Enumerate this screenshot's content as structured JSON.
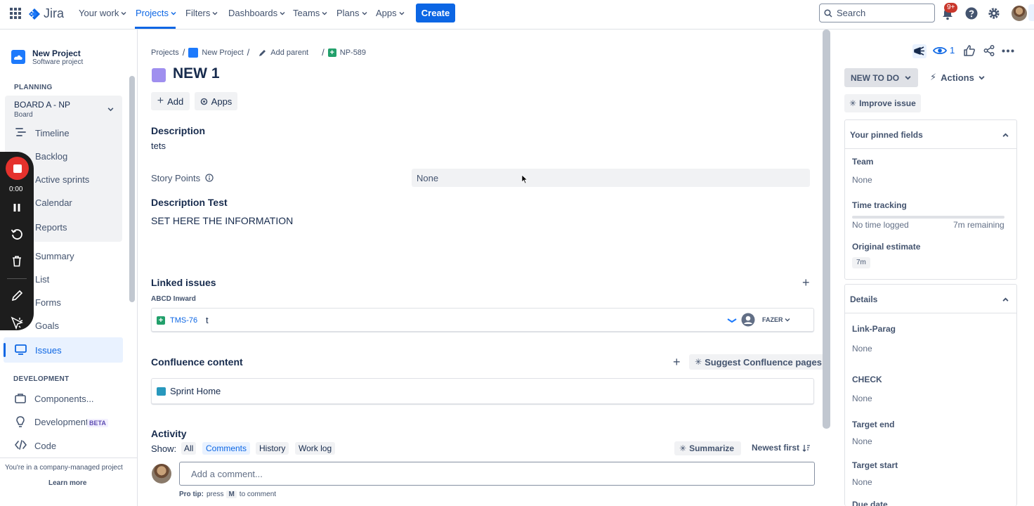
{
  "topnav": {
    "brand": "Jira",
    "items": [
      "Your work",
      "Projects",
      "Filters",
      "Dashboards",
      "Teams",
      "Plans",
      "Apps"
    ],
    "create": "Create",
    "search_placeholder": "Search",
    "notif_badge": "9+"
  },
  "sidebar": {
    "project_name": "New Project",
    "project_type": "Software project",
    "planning_header": "PLANNING",
    "board_name": "BOARD A - NP",
    "board_sub": "Board",
    "planning_items": [
      "Timeline",
      "Backlog",
      "Active sprints",
      "Calendar",
      "Reports"
    ],
    "other_items": [
      "Summary",
      "List",
      "Forms",
      "Goals",
      "Issues"
    ],
    "development_header": "DEVELOPMENT",
    "dev_items": [
      "Components...",
      "Development",
      "Code"
    ],
    "beta": "BETA",
    "footer_text": "You're in a company-managed project",
    "learn_more": "Learn more"
  },
  "recorder": {
    "time": "0:00"
  },
  "breadcrumb": {
    "projects": "Projects",
    "project": "New Project",
    "add_parent": "Add parent",
    "issue_key": "NP-589"
  },
  "issue": {
    "title": "NEW 1",
    "add": "Add",
    "apps": "Apps",
    "description_label": "Description",
    "description_value": "tets",
    "story_points_label": "Story Points",
    "story_points_value": "None",
    "desc_test_label": "Description Test",
    "desc_test_value": "SET HERE THE INFORMATION"
  },
  "linked": {
    "header": "Linked issues",
    "relation": "ABCD Inward",
    "key": "TMS-76",
    "summary": "t",
    "status": "FAZER"
  },
  "confluence": {
    "header": "Confluence content",
    "suggest": "Suggest Confluence pages",
    "page": "Sprint Home"
  },
  "activity": {
    "header": "Activity",
    "show": "Show:",
    "tabs": [
      "All",
      "Comments",
      "History",
      "Work log"
    ],
    "summarize": "Summarize",
    "sort": "Newest first",
    "comment_placeholder": "Add a comment...",
    "tip_prefix": "Pro tip:",
    "tip_press": "press",
    "tip_key": "M",
    "tip_suffix": "to comment"
  },
  "right": {
    "watch_count": "1",
    "status": "NEW TO DO",
    "actions": "Actions",
    "improve": "Improve issue",
    "pinned_header": "Your pinned fields",
    "team_label": "Team",
    "team_value": "None",
    "tt_label": "Time tracking",
    "tt_logged": "No time logged",
    "tt_remaining": "7m remaining",
    "oe_label": "Original estimate",
    "oe_value": "7m",
    "details_header": "Details",
    "link_parag_label": "Link-Parag",
    "link_parag_value": "None",
    "check_label": "CHECK",
    "check_value": "None",
    "target_end_label": "Target end",
    "target_end_value": "None",
    "target_start_label": "Target start",
    "target_start_value": "None",
    "due_date_label": "Due date"
  },
  "colors": {
    "accent": "#0c66e4",
    "epic": "#9f8fef",
    "story": "#22a06b"
  }
}
